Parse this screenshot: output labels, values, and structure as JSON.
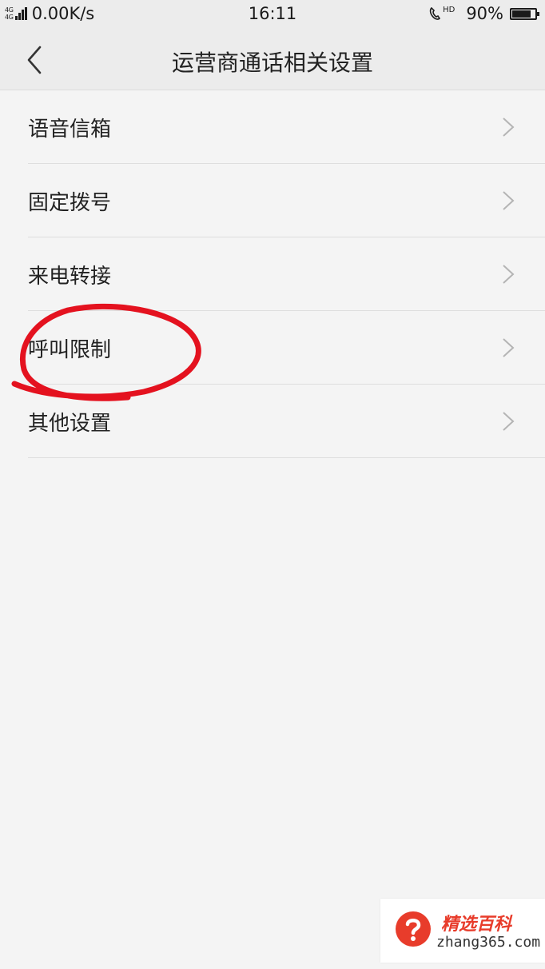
{
  "status_bar": {
    "network_types": [
      "4G",
      "4G"
    ],
    "speed": "0.00K/s",
    "time": "16:11",
    "hd_label": "HD",
    "battery": "90%",
    "battery_level": 0.9
  },
  "header": {
    "back_icon": "chevron-left-icon",
    "title": "运营商通话相关设置"
  },
  "menu": {
    "items": [
      {
        "label": "语音信箱",
        "icon": "chevron-right-icon"
      },
      {
        "label": "固定拨号",
        "icon": "chevron-right-icon"
      },
      {
        "label": "来电转接",
        "icon": "chevron-right-icon"
      },
      {
        "label": "呼叫限制",
        "icon": "chevron-right-icon",
        "annotated": true
      },
      {
        "label": "其他设置",
        "icon": "chevron-right-icon"
      }
    ]
  },
  "annotation": {
    "color": "#e4121f",
    "shape": "hand-drawn-circle"
  },
  "watermark": {
    "title": "精选百科",
    "domain": "zhang365.com",
    "icon": "question-mark-icon",
    "color": "#e83c2b"
  }
}
